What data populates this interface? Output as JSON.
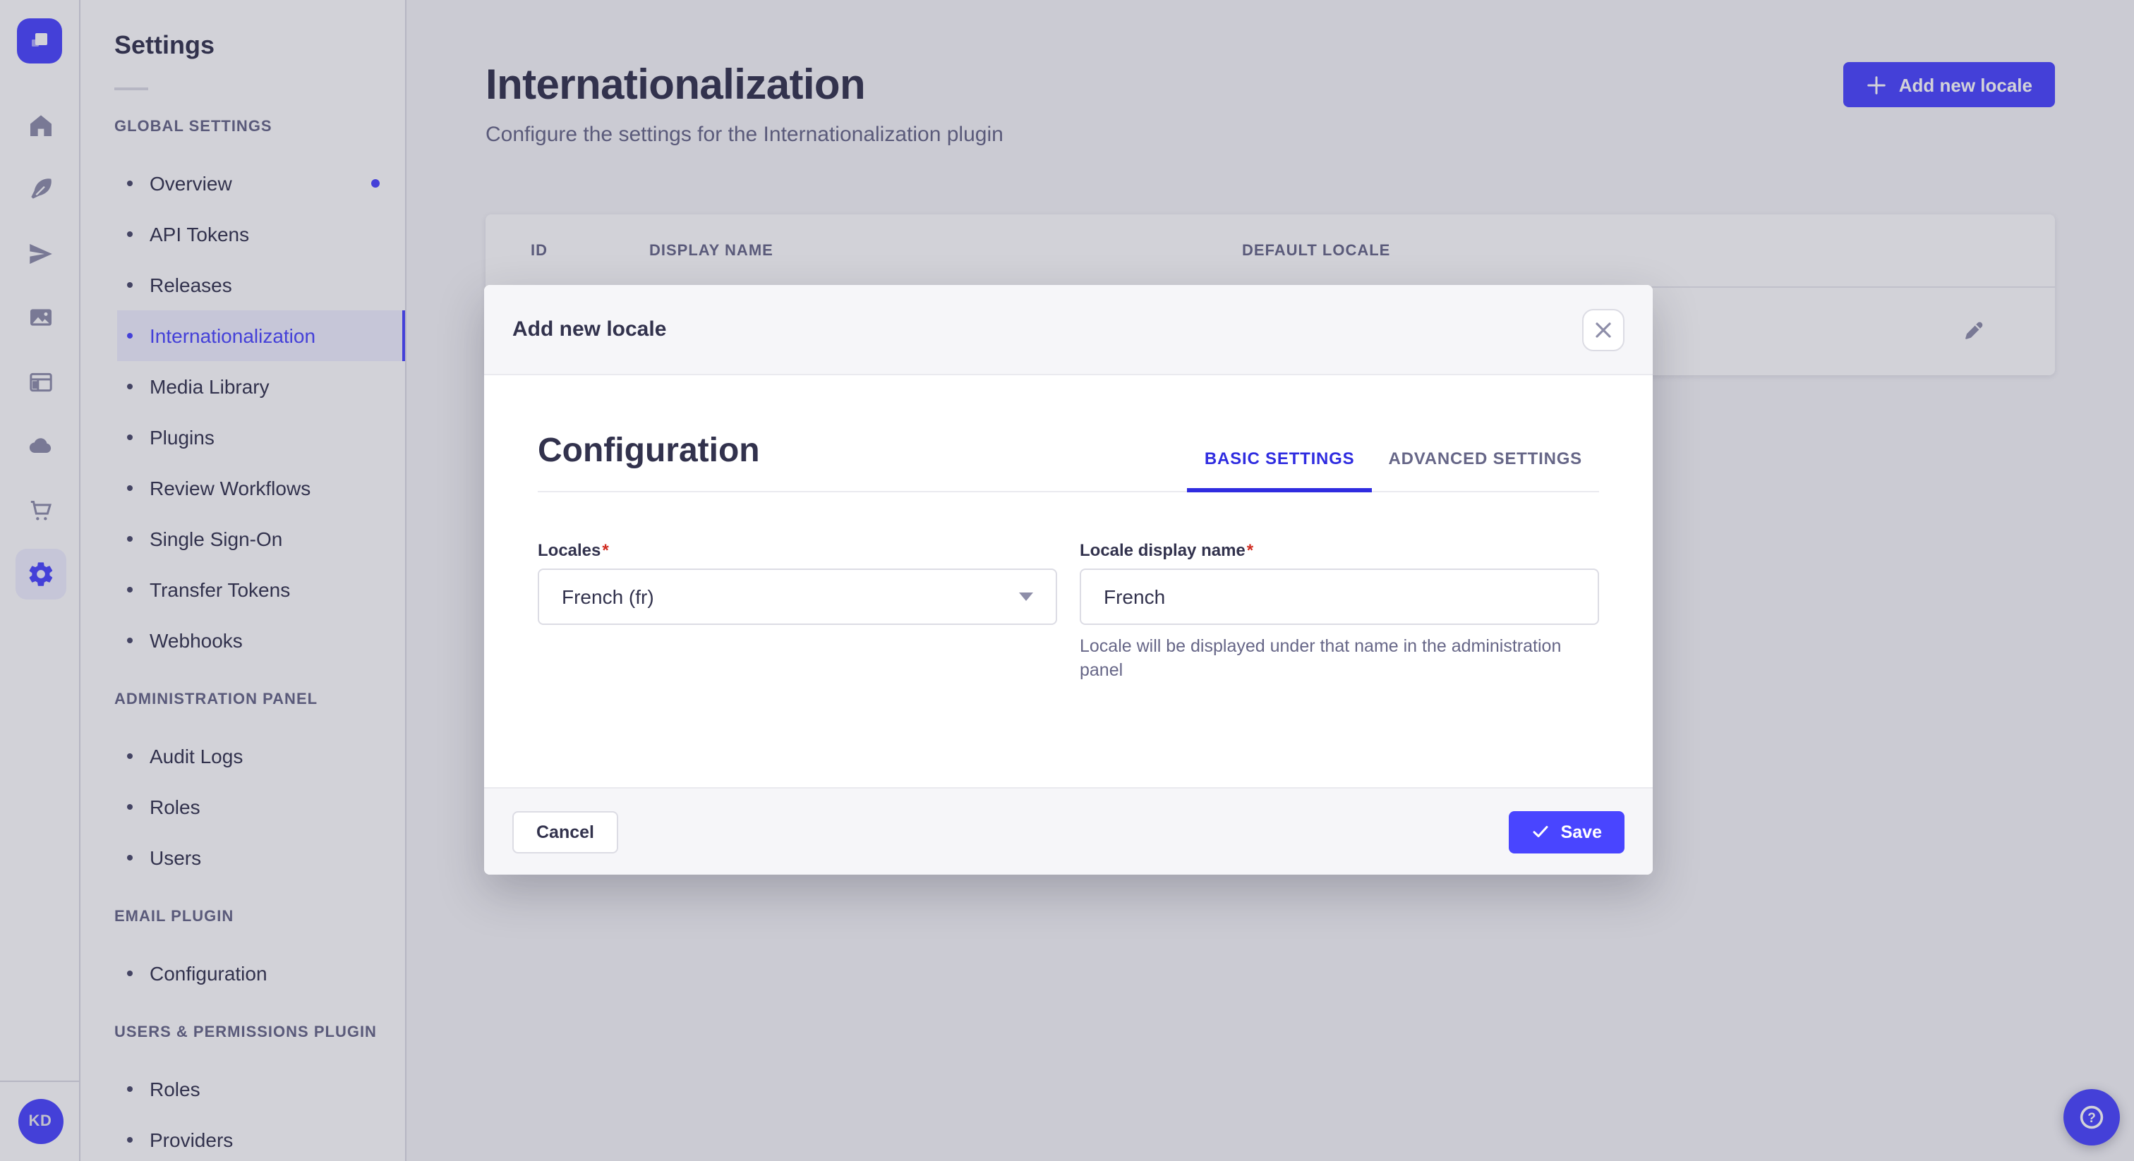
{
  "nav_rail": {
    "logo_icon": "strapi-logo",
    "icons": [
      "home-icon",
      "content-manager-icon",
      "deploy-icon",
      "media-library-icon",
      "content-type-builder-icon",
      "cloud-icon",
      "marketplace-icon",
      "settings-icon"
    ],
    "active_icon": "settings-icon",
    "user_initials": "KD",
    "help_icon": "help-icon"
  },
  "sidebar": {
    "title": "Settings",
    "sections": [
      {
        "label": "GLOBAL SETTINGS",
        "items": [
          {
            "label": "Overview",
            "notification": true
          },
          {
            "label": "API Tokens"
          },
          {
            "label": "Releases"
          },
          {
            "label": "Internationalization",
            "active": true
          },
          {
            "label": "Media Library"
          },
          {
            "label": "Plugins"
          },
          {
            "label": "Review Workflows"
          },
          {
            "label": "Single Sign-On"
          },
          {
            "label": "Transfer Tokens"
          },
          {
            "label": "Webhooks"
          }
        ]
      },
      {
        "label": "ADMINISTRATION PANEL",
        "items": [
          {
            "label": "Audit Logs"
          },
          {
            "label": "Roles"
          },
          {
            "label": "Users"
          }
        ]
      },
      {
        "label": "EMAIL PLUGIN",
        "items": [
          {
            "label": "Configuration"
          }
        ]
      },
      {
        "label": "USERS & PERMISSIONS PLUGIN",
        "items": [
          {
            "label": "Roles"
          },
          {
            "label": "Providers"
          }
        ]
      }
    ]
  },
  "page": {
    "title": "Internationalization",
    "subtitle": "Configure the settings for the Internationalization plugin",
    "add_button_label": "Add new locale"
  },
  "table": {
    "columns": [
      "ID",
      "DISPLAY NAME",
      "DEFAULT LOCALE"
    ],
    "row_action_icon": "edit-pencil-icon"
  },
  "modal": {
    "title": "Add new locale",
    "close_icon": "close-icon",
    "section_title": "Configuration",
    "tabs": [
      {
        "label": "BASIC SETTINGS",
        "active": true
      },
      {
        "label": "ADVANCED SETTINGS",
        "active": false
      }
    ],
    "locales_field": {
      "label": "Locales",
      "required_mark": "*",
      "value": "French (fr)"
    },
    "display_name_field": {
      "label": "Locale display name",
      "required_mark": "*",
      "value": "French",
      "hint": "Locale will be displayed under that name in the administration panel"
    },
    "cancel_label": "Cancel",
    "save_label": "Save"
  },
  "colors": {
    "primary": "#4945ff",
    "active_tab": "#2f2ce0",
    "text": "#32324d",
    "muted": "#666687",
    "danger": "#d02b20"
  }
}
